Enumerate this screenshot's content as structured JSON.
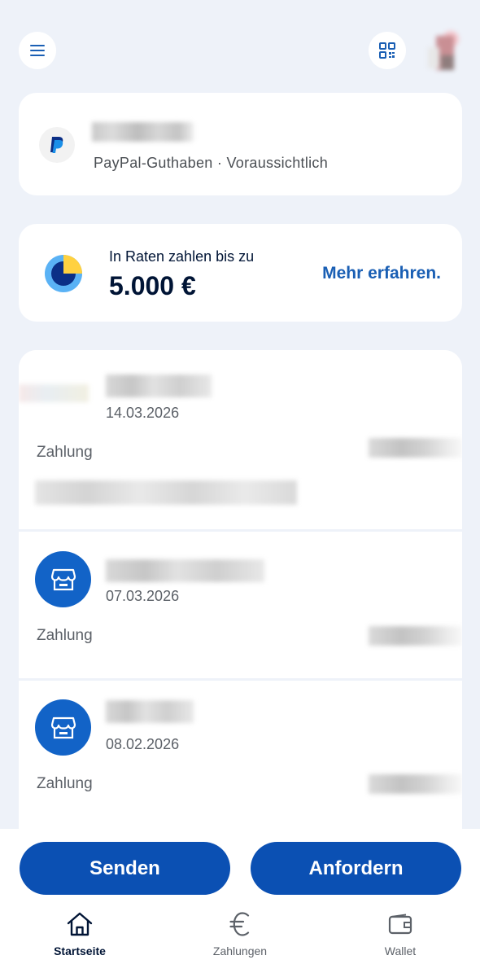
{
  "header": {
    "menu_icon": "hamburger-menu-icon",
    "qr_icon": "qr-code-icon",
    "avatar_icon": "profile-avatar"
  },
  "balance": {
    "logo": "paypal-logo",
    "subtitle": "PayPal-Guthaben · Voraussichtlich"
  },
  "credit": {
    "label": "In Raten zahlen bis zu",
    "amount": "5.000 €",
    "link": "Mehr erfahren.",
    "icon": "pie-chart-icon"
  },
  "transactions": [
    {
      "date": "14.03.2026",
      "type": "Zahlung",
      "icon": "merchant-thumbnail"
    },
    {
      "date": "07.03.2026",
      "type": "Zahlung",
      "icon": "store-icon"
    },
    {
      "date": "08.02.2026",
      "type": "Zahlung",
      "icon": "store-icon"
    }
  ],
  "actions": {
    "send": "Senden",
    "request": "Anfordern"
  },
  "nav": {
    "home": "Startseite",
    "payments": "Zahlungen",
    "wallet": "Wallet"
  },
  "colors": {
    "background": "#eef2f9",
    "primary_button": "#0b50b3",
    "link": "#1a5fb4",
    "merchant_icon_bg": "#1263c7"
  }
}
